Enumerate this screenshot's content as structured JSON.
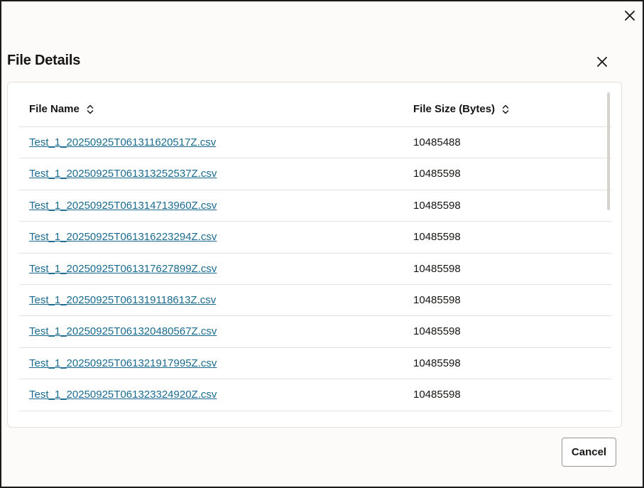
{
  "dialog": {
    "title": "File Details",
    "cancel_label": "Cancel"
  },
  "table": {
    "columns": [
      "File Name",
      "File Size (Bytes)"
    ],
    "rows": [
      {
        "name": "Test_1_20250925T061311620517Z.csv",
        "size": "10485488"
      },
      {
        "name": "Test_1_20250925T061313252537Z.csv",
        "size": "10485598"
      },
      {
        "name": "Test_1_20250925T061314713960Z.csv",
        "size": "10485598"
      },
      {
        "name": "Test_1_20250925T061316223294Z.csv",
        "size": "10485598"
      },
      {
        "name": "Test_1_20250925T061317627899Z.csv",
        "size": "10485598"
      },
      {
        "name": "Test_1_20250925T061319118613Z.csv",
        "size": "10485598"
      },
      {
        "name": "Test_1_20250925T061320480567Z.csv",
        "size": "10485598"
      },
      {
        "name": "Test_1_20250925T061321917995Z.csv",
        "size": "10485598"
      },
      {
        "name": "Test_1_20250925T061323324920Z.csv",
        "size": "10485598"
      }
    ]
  },
  "icons": {
    "outer_close": "close-icon",
    "dialog_close": "close-icon",
    "sort": "sort-icon"
  },
  "colors": {
    "link": "#1a6b8f",
    "text": "#161513",
    "divider": "#e4e1dd"
  }
}
